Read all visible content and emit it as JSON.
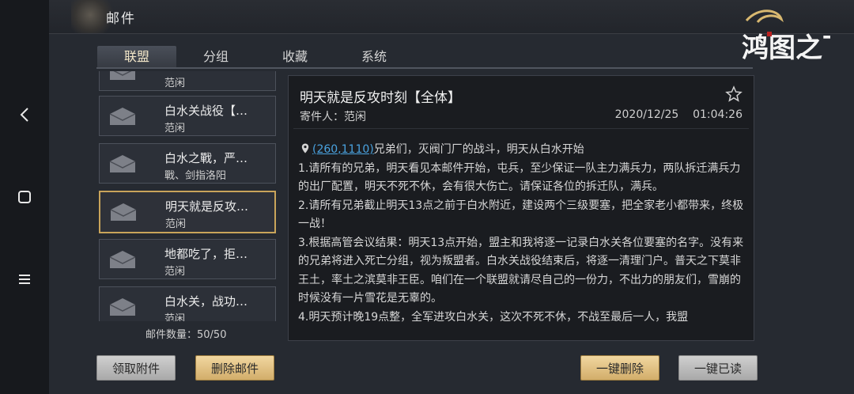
{
  "header": {
    "title": "邮件",
    "logo_text": "鸿图之下"
  },
  "tabs": [
    {
      "label": "联盟"
    },
    {
      "label": "分组"
    },
    {
      "label": "收藏"
    },
    {
      "label": "系统"
    }
  ],
  "mail_list": {
    "items": [
      {
        "title": "",
        "sender": "范闲"
      },
      {
        "title": "白水关战役【…",
        "sender": "范闲"
      },
      {
        "title": "白水之戰，严…",
        "sender": "戰、剑指洛阳"
      },
      {
        "title": "明天就是反攻…",
        "sender": "范闲"
      },
      {
        "title": "地都吃了，拒…",
        "sender": "范闲"
      },
      {
        "title": "白水关，战功…",
        "sender": "范闲"
      }
    ],
    "count_label": "邮件数量：50/50"
  },
  "detail": {
    "title": "明天就是反攻时刻【全体】",
    "sender": "寄件人：范闲",
    "date": "2020/12/25",
    "time": "01:04:26",
    "coord": "(260,1110)",
    "first_line": "兄弟们，灭阀门厂的战斗，明天从白水开始",
    "paragraphs": [
      "1.请所有的兄弟，明天看见本邮件开始，屯兵，至少保证一队主力满兵力，两队拆迁满兵力的出厂配置，明天不死不休，会有很大伤亡。请保证各位的拆迁队，满兵。",
      "2.请所有兄弟截止明天13点之前于白水附近，建设两个三级要塞，把全家老小都带来，终极一战！",
      "3.根据高管会议结果：明天13点开始，盟主和我将逐一记录白水关各位要塞的名字。没有来的兄弟将进入死亡分组，视为叛盟者。白水关战役结束后，将逐一清理门户。普天之下莫非王土，率土之滨莫非王臣。咱们在一个联盟就请尽自己的一份力，不出力的朋友们，雪崩的时候没有一片雪花是无辜的。",
      "4.明天预计晚19点整，全军进攻白水关，这次不死不休，不战至最后一人，我盟"
    ]
  },
  "buttons": {
    "claim": "领取附件",
    "delete": "删除邮件",
    "delete_all": "一键删除",
    "read_all": "一键已读"
  },
  "colors": {
    "accent_gold": "#c9a45a",
    "link_blue": "#4aa3e0",
    "bg": "#262a31"
  }
}
